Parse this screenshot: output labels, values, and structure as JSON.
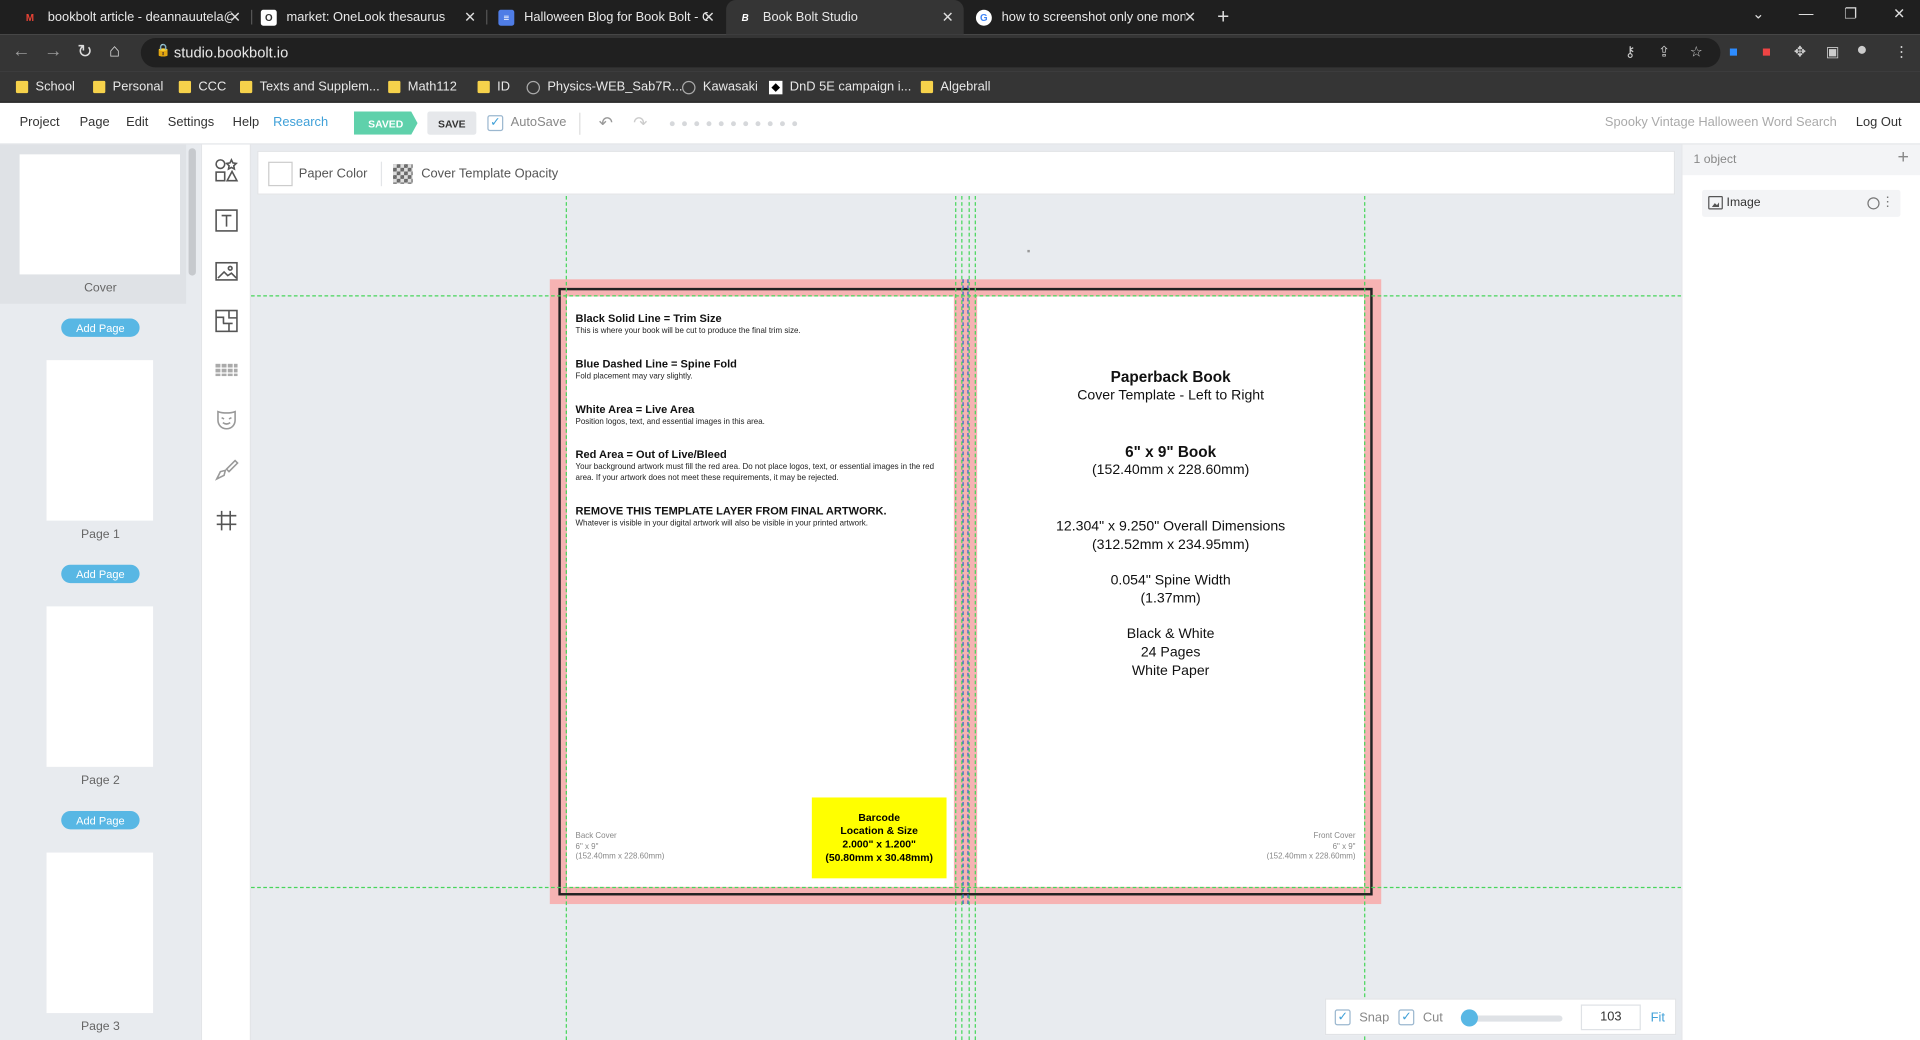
{
  "browser": {
    "tabs": [
      {
        "label": "bookbolt article - deannauutela@",
        "icon": "gmail-icon"
      },
      {
        "label": "market: OneLook thesaurus",
        "icon": "onelook-icon"
      },
      {
        "label": "Halloween Blog for Book Bolt - G",
        "icon": "docs-icon"
      },
      {
        "label": "Book Bolt Studio",
        "icon": "bookbolt-icon"
      },
      {
        "label": "how to screenshot only one mon",
        "icon": "google-icon"
      }
    ],
    "url": "studio.bookbolt.io",
    "bookmarks": [
      {
        "label": "School",
        "icon": "folder-icon"
      },
      {
        "label": "Personal",
        "icon": "folder-icon"
      },
      {
        "label": "CCC",
        "icon": "folder-icon"
      },
      {
        "label": "Texts and Supplem...",
        "icon": "folder-icon"
      },
      {
        "label": "Math112",
        "icon": "folder-icon"
      },
      {
        "label": "ID",
        "icon": "folder-icon"
      },
      {
        "label": "Physics-WEB_Sab7R...",
        "icon": "globe-icon"
      },
      {
        "label": "Kawasaki",
        "icon": "globe-icon"
      },
      {
        "label": "DnD 5E campaign i...",
        "icon": "dnd-icon"
      },
      {
        "label": "Algebrall",
        "icon": "folder-icon"
      }
    ]
  },
  "app_menu": {
    "items": [
      "Project",
      "Page",
      "Edit",
      "Settings",
      "Help",
      "Research"
    ],
    "saved_label": "SAVED",
    "save_label": "SAVE",
    "autosave_label": "AutoSave",
    "autosave_checked": true,
    "project_title": "Spooky Vintage Halloween Word Search",
    "logout_label": "Log Out"
  },
  "pages_panel": {
    "cover_label": "Cover",
    "add_page_label": "Add Page",
    "pages": [
      "Page 1",
      "Page 2",
      "Page 3"
    ]
  },
  "subtoolbar": {
    "paper_color_label": "Paper Color",
    "opacity_label": "Cover Template Opacity"
  },
  "template": {
    "back_sections": [
      {
        "heading": "Black Solid Line = Trim Size",
        "body": "This is where your book will be cut to produce the final trim size."
      },
      {
        "heading": "Blue Dashed Line = Spine Fold",
        "body": "Fold placement may vary slightly."
      },
      {
        "heading": "White Area = Live Area",
        "body": "Position logos, text, and essential images in this area."
      },
      {
        "heading": "Red Area = Out of Live/Bleed",
        "body": "Your background artwork must fill the red area. Do not place logos, text, or essential images in the red area. If your artwork does not meet these requirements, it may be rejected."
      },
      {
        "heading": "REMOVE THIS TEMPLATE LAYER FROM FINAL ARTWORK.",
        "body": "Whatever is visible in your digital artwork will also be visible in your printed artwork."
      }
    ],
    "back_corner": [
      "Back Cover",
      "6\" x 9\"",
      "(152.40mm x 228.60mm)"
    ],
    "barcode": [
      "Barcode",
      "Location & Size",
      "2.000\" x 1.200\"",
      "(50.80mm x 30.48mm)"
    ],
    "front": {
      "title": "Paperback Book",
      "subtitle": "Cover Template - Left to Right",
      "size": "6\" x 9\" Book",
      "size_mm": "(152.40mm x 228.60mm)",
      "overall": "12.304\" x 9.250\" Overall Dimensions",
      "overall_mm": "(312.52mm x 234.95mm)",
      "spine": "0.054\" Spine Width",
      "spine_mm": "(1.37mm)",
      "color": "Black & White",
      "pages": "24 Pages",
      "paper": "White Paper"
    },
    "front_corner": [
      "Front Cover",
      "6\" x 9\"",
      "(152.40mm x 228.60mm)"
    ],
    "colors": {
      "bleed": "#f6b3b3",
      "guide": "#47d65b",
      "spine": "#3366cc",
      "barcode": "#ffff00"
    }
  },
  "zoom": {
    "snap_label": "Snap",
    "snap_checked": true,
    "cut_label": "Cut",
    "cut_checked": true,
    "value": "103",
    "fit_label": "Fit"
  },
  "layers": {
    "count_label": "1 object",
    "items": [
      {
        "name": "Image",
        "icon": "image-icon"
      }
    ]
  },
  "accent_color": "#3fa0d8"
}
